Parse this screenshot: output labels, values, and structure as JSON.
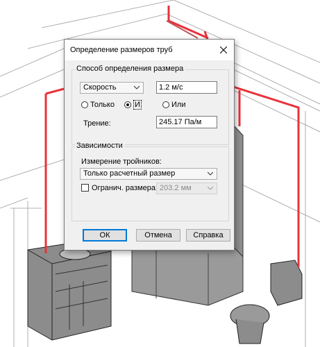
{
  "dialog": {
    "title": "Определение размеров труб",
    "close_icon": "close-icon"
  },
  "method_group": {
    "label": "Способ определения размера",
    "method_select": {
      "value": "Скорость",
      "icon": "chevron-down-icon"
    },
    "velocity_value": "1.2 м/с",
    "radio_only": {
      "label": "Только",
      "checked": false
    },
    "radio_and": {
      "label": "И",
      "checked": true
    },
    "radio_or": {
      "label": "Или",
      "checked": false
    },
    "friction_label": "Трение:",
    "friction_value": "245.17 Па/м"
  },
  "constraints_group": {
    "label": "Зависимости",
    "tee_sizing_label": "Измерение тройников:",
    "tee_sizing_select": {
      "value": "Только расчетный размер",
      "icon": "chevron-down-icon"
    },
    "restrict_size": {
      "label": "Огранич. размера:",
      "checked": false
    },
    "max_size_select": {
      "value": "203.2 мм",
      "icon": "chevron-down-icon"
    }
  },
  "buttons": {
    "ok": "ОК",
    "cancel": "Отмена",
    "help": "Справка"
  },
  "colors": {
    "pipe": "#e8323c",
    "fixture": "#8c8c8c",
    "dialog_bg": "#f0f0f0",
    "focus": "#0078d7"
  }
}
